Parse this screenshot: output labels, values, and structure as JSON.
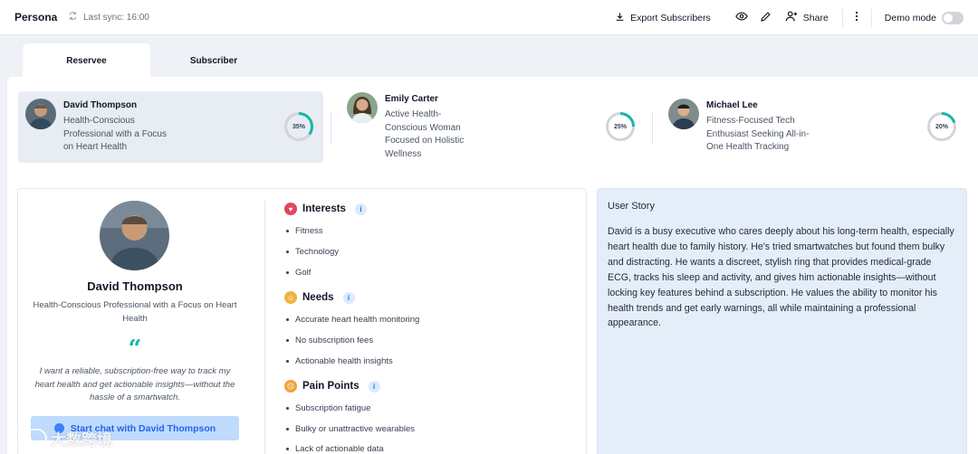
{
  "app": {
    "title": "Persona",
    "sync": "Last sync: 16:00"
  },
  "toolbar": {
    "export_label": "Export Subscribers",
    "share_label": "Share",
    "demo_label": "Demo mode",
    "demo_enabled": false
  },
  "tabs": [
    {
      "label": "Reservee",
      "active": true
    },
    {
      "label": "Subscriber",
      "active": false
    }
  ],
  "personas": [
    {
      "name": "David Thompson",
      "desc": "Health-Conscious Professional with a Focus on Heart Health",
      "match": "35%",
      "match_value": 35,
      "selected": true
    },
    {
      "name": "Emily Carter",
      "desc": "Active Health-Conscious Woman Focused on Holistic Wellness",
      "match": "25%",
      "match_value": 25,
      "selected": false
    },
    {
      "name": "Michael Lee",
      "desc": "Fitness-Focused Tech Enthusiast Seeking All-in-One Health Tracking",
      "match": "20%",
      "match_value": 20,
      "selected": false
    }
  ],
  "profile": {
    "name": "David Thompson",
    "subtitle": "Health-Conscious Professional with a Focus on Heart Health",
    "quote_mark": "“",
    "quote": "I want a reliable, subscription-free way to track my heart health and get actionable insights—without the hassle of a smartwatch.",
    "chat_button": "Start chat with David Thompson"
  },
  "sections": [
    {
      "title": "Interests",
      "items": [
        "Fitness",
        "Technology",
        "Golf"
      ]
    },
    {
      "title": "Needs",
      "items": [
        "Accurate heart health monitoring",
        "No subscription fees",
        "Actionable health insights"
      ]
    },
    {
      "title": "Pain Points",
      "items": [
        "Subscription fatigue",
        "Bulky or unattractive wearables",
        "Lack of actionable data"
      ]
    }
  ],
  "story": {
    "title": "User Story",
    "text": "David is a busy executive who cares deeply about his long-term health, especially heart health due to family history. He's tried smartwatches but found them bulky and distracting. He wants a discreet, stylish ring that provides medical-grade ECG, tracks his sleep and activity, and gives him actionable insights—without locking key features behind a subscription. He values the ability to monitor his health trends and get early warnings, all while maintaining a professional appearance."
  },
  "watermark": "大数跨境",
  "colors": {
    "accent": "#14b8a6",
    "ring_track": "#d1d5db",
    "selected_bg": "#e8ecf3",
    "story_bg": "#e5edf9"
  }
}
